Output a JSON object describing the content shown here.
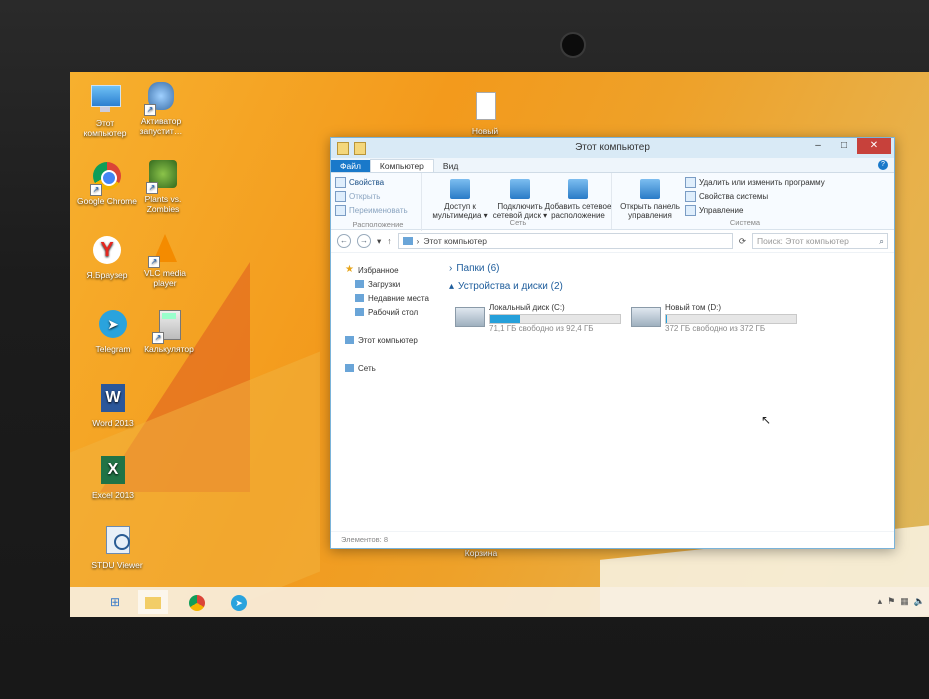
{
  "desktop": {
    "icons": [
      {
        "label": "Этот компьютер",
        "icon": "computer-icon"
      },
      {
        "label": "Активатор запустит…",
        "icon": "activator-icon"
      },
      {
        "label": "Google Chrome",
        "icon": "chrome-icon"
      },
      {
        "label": "Plants vs. Zombies",
        "icon": "plants-vs-zombies-icon"
      },
      {
        "label": "Я.Браузер",
        "icon": "yandex-browser-icon"
      },
      {
        "label": "VLC media player",
        "icon": "vlc-icon"
      },
      {
        "label": "Telegram",
        "icon": "telegram-icon"
      },
      {
        "label": "Калькулятор",
        "icon": "calculator-icon"
      },
      {
        "label": "Word 2013",
        "icon": "word-icon"
      },
      {
        "label": "Excel 2013",
        "icon": "excel-icon"
      },
      {
        "label": "STDU Viewer",
        "icon": "stdu-viewer-icon"
      }
    ],
    "file_new": "Новый",
    "recycle_bin": "Корзина"
  },
  "window": {
    "title": "Этот компьютер",
    "tabs": [
      "Файл",
      "Компьютер",
      "Вид"
    ],
    "ribbon": {
      "location": {
        "items": [
          "Свойства",
          "Открыть",
          "Переименовать"
        ],
        "label": "Расположение"
      },
      "network": {
        "media_access": "Доступ к мультимедиа ▾",
        "map_drive": "Подключить сетевой диск ▾",
        "add_location": "Добавить сетевое расположение",
        "label": "Сеть"
      },
      "system": {
        "control_panel": "Открыть панель управления",
        "uninstall": "Удалить или изменить программу",
        "properties": "Свойства системы",
        "manage": "Управление",
        "label": "Система"
      }
    },
    "address": "Этот компьютер",
    "search_placeholder": "Поиск: Этот компьютер",
    "nav": {
      "favorites": "Избранное",
      "downloads": "Загрузки",
      "recent": "Недавние места",
      "desktop": "Рабочий стол",
      "this_pc": "Этот компьютер",
      "network": "Сеть"
    },
    "sections": {
      "folders": "Папки (6)",
      "devices": "Устройства и диски (2)"
    },
    "drives": [
      {
        "name": "Локальный диск (C:)",
        "free": "71,1 ГБ свободно из 92,4 ГБ",
        "used_pct": 23
      },
      {
        "name": "Новый том (D:)",
        "free": "372 ГБ свободно из 372 ГБ",
        "used_pct": 1
      }
    ],
    "status": "Элементов: 8"
  },
  "colors": {
    "accent": "#1979ca",
    "drive_fill": "#26a0da",
    "close": "#c7413b"
  }
}
